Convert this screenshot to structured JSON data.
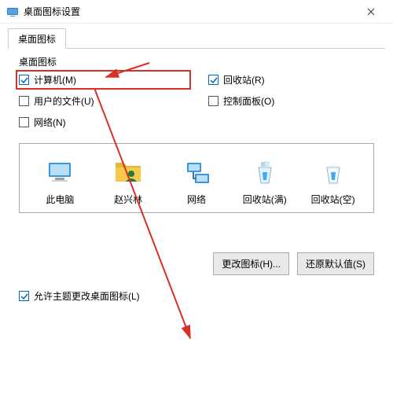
{
  "window": {
    "title": "桌面图标设置"
  },
  "tab": {
    "label": "桌面图标"
  },
  "group": {
    "label": "桌面图标"
  },
  "checkboxes": {
    "computer": {
      "label": "计算机(M)",
      "checked": true,
      "highlighted": true
    },
    "recycle": {
      "label": "回收站(R)",
      "checked": true
    },
    "userfiles": {
      "label": "用户的文件(U)",
      "checked": false
    },
    "ctrlpanel": {
      "label": "控制面板(O)",
      "checked": false
    },
    "network": {
      "label": "网络(N)",
      "checked": false
    }
  },
  "icons": {
    "thispc": {
      "label": "此电脑"
    },
    "userfolder": {
      "label": "赵兴林"
    },
    "network": {
      "label": "网络"
    },
    "recyclefull": {
      "label": "回收站(满)"
    },
    "recycleempty": {
      "label": "回收站(空)"
    }
  },
  "buttons": {
    "change": "更改图标(H)...",
    "restore": "还原默认值(S)"
  },
  "allow_theme": {
    "label": "允许主题更改桌面图标(L)",
    "checked": true
  }
}
